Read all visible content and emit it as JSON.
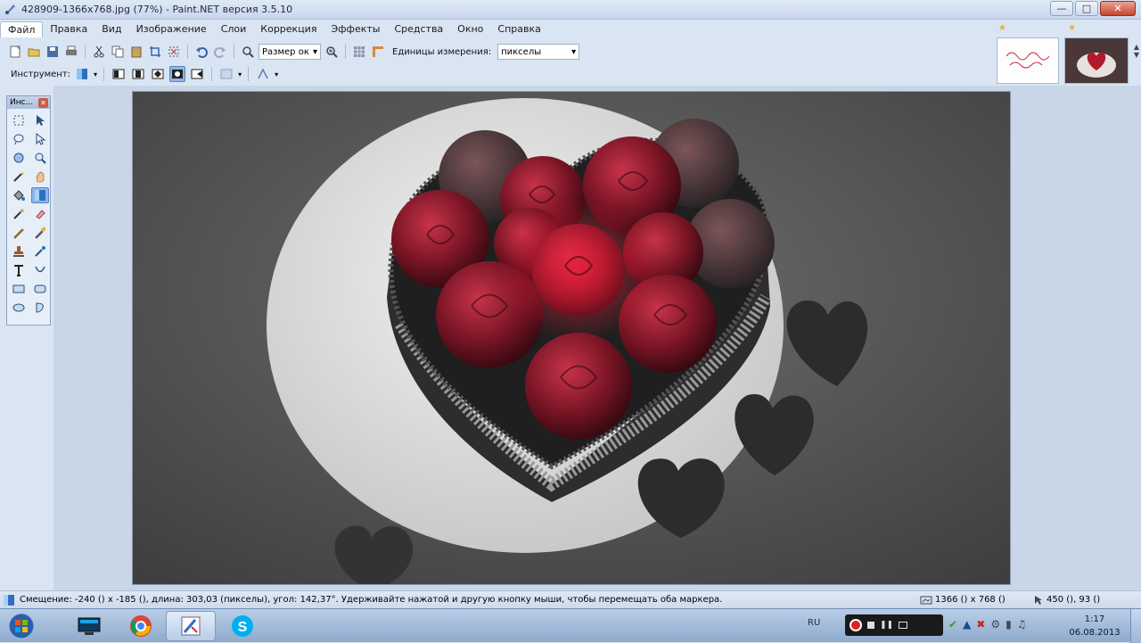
{
  "window": {
    "title": "428909-1366x768.jpg (77%) - Paint.NET версия 3.5.10"
  },
  "menu": [
    "Файл",
    "Правка",
    "Вид",
    "Изображение",
    "Слои",
    "Коррекция",
    "Эффекты",
    "Средства",
    "Окно",
    "Справка"
  ],
  "toolbar": {
    "zoom_combo": "Размер ок",
    "units_label": "Единицы измерения:",
    "units_value": "пикселы",
    "tool_label": "Инструмент:"
  },
  "tools_panel": {
    "title": "Инс...",
    "tools": [
      "rectangle-select",
      "move-selection",
      "lasso-select",
      "move-selected",
      "ellipse-select",
      "zoom",
      "magic-wand",
      "pan",
      "paint-bucket",
      "gradient",
      "paintbrush",
      "eraser",
      "pencil",
      "color-picker",
      "clone-stamp",
      "recolor",
      "text",
      "line-curve",
      "rectangle",
      "rounded-rectangle",
      "ellipse",
      "freeform-shape"
    ],
    "selected_tool": "gradient"
  },
  "status": {
    "message": "Смещение: -240 () x -185 (), длина: 303,03 (пикселы), угол: 142,37°. Удерживайте нажатой и другую кнопку мыши, чтобы перемещать оба маркера.",
    "image_size": "1366 () x 768 ()",
    "cursor_pos": "450 (), 93 ()"
  },
  "taskbar": {
    "lang": "RU",
    "time": "1:17",
    "date": "06.08.2013"
  }
}
